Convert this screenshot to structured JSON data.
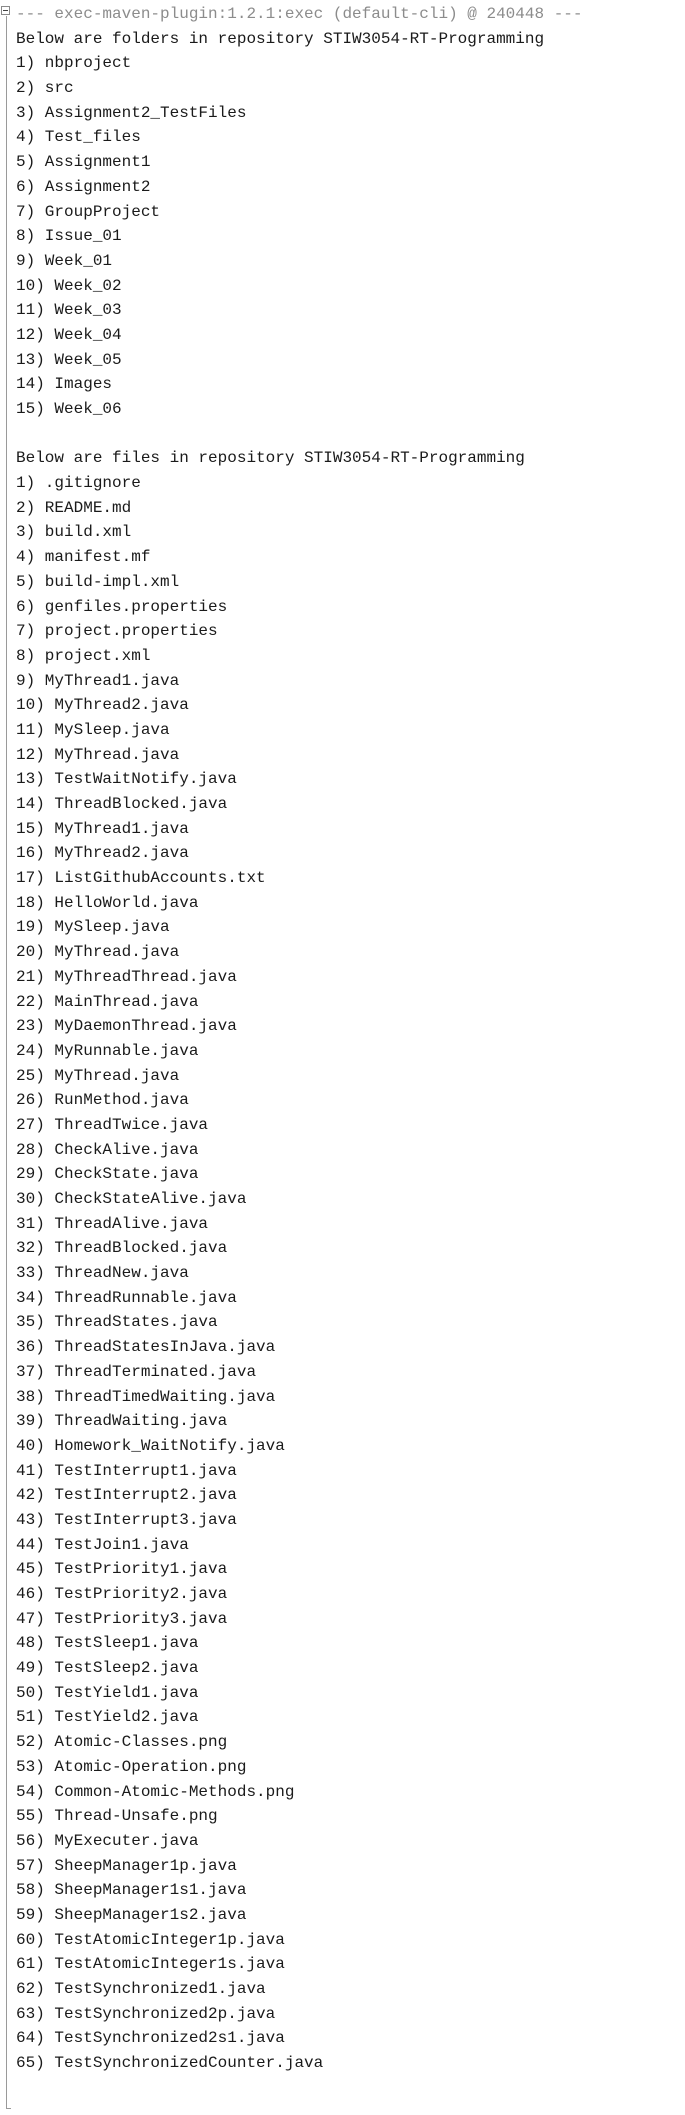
{
  "header": "--- exec-maven-plugin:1.2.1:exec (default-cli) @ 240448 ---",
  "folders_heading": "Below are folders in repository STIW3054-RT-Programming",
  "folders": [
    "1) nbproject",
    "2) src",
    "3) Assignment2_TestFiles",
    "4) Test_files",
    "5) Assignment1",
    "6) Assignment2",
    "7) GroupProject",
    "8) Issue_01",
    "9) Week_01",
    "10) Week_02",
    "11) Week_03",
    "12) Week_04",
    "13) Week_05",
    "14) Images",
    "15) Week_06"
  ],
  "files_heading": "Below are files in repository STIW3054-RT-Programming",
  "files": [
    "1) .gitignore",
    "2) README.md",
    "3) build.xml",
    "4) manifest.mf",
    "5) build-impl.xml",
    "6) genfiles.properties",
    "7) project.properties",
    "8) project.xml",
    "9) MyThread1.java",
    "10) MyThread2.java",
    "11) MySleep.java",
    "12) MyThread.java",
    "13) TestWaitNotify.java",
    "14) ThreadBlocked.java",
    "15) MyThread1.java",
    "16) MyThread2.java",
    "17) ListGithubAccounts.txt",
    "18) HelloWorld.java",
    "19) MySleep.java",
    "20) MyThread.java",
    "21) MyThreadThread.java",
    "22) MainThread.java",
    "23) MyDaemonThread.java",
    "24) MyRunnable.java",
    "25) MyThread.java",
    "26) RunMethod.java",
    "27) ThreadTwice.java",
    "28) CheckAlive.java",
    "29) CheckState.java",
    "30) CheckStateAlive.java",
    "31) ThreadAlive.java",
    "32) ThreadBlocked.java",
    "33) ThreadNew.java",
    "34) ThreadRunnable.java",
    "35) ThreadStates.java",
    "36) ThreadStatesInJava.java",
    "37) ThreadTerminated.java",
    "38) ThreadTimedWaiting.java",
    "39) ThreadWaiting.java",
    "40) Homework_WaitNotify.java",
    "41) TestInterrupt1.java",
    "42) TestInterrupt2.java",
    "43) TestInterrupt3.java",
    "44) TestJoin1.java",
    "45) TestPriority1.java",
    "46) TestPriority2.java",
    "47) TestPriority3.java",
    "48) TestSleep1.java",
    "49) TestSleep2.java",
    "50) TestYield1.java",
    "51) TestYield2.java",
    "52) Atomic-Classes.png",
    "53) Atomic-Operation.png",
    "54) Common-Atomic-Methods.png",
    "55) Thread-Unsafe.png",
    "56) MyExecuter.java",
    "57) SheepManager1p.java",
    "58) SheepManager1s1.java",
    "59) SheepManager1s2.java",
    "60) TestAtomicInteger1p.java",
    "61) TestAtomicInteger1s.java",
    "62) TestSynchronized1.java",
    "63) TestSynchronized2p.java",
    "64) TestSynchronized2s1.java",
    "65) TestSynchronizedCounter.java"
  ]
}
